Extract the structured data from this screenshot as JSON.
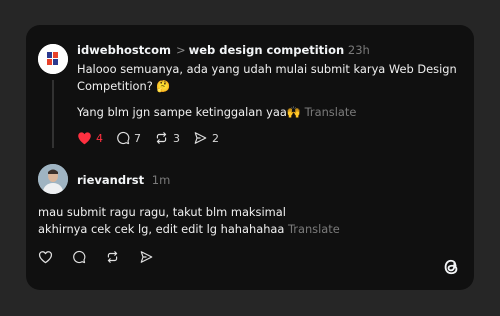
{
  "post": {
    "author": "idwebhostcom",
    "separator": ">",
    "community": "web design competition",
    "time": "23h",
    "line1": "Halooo semuanya, ada yang udah mulai submit karya Web Design",
    "line2": "Competition? 🤔",
    "line3": "Yang blm jgn sampe ketinggalan yaa🙌",
    "translate": "Translate",
    "likes": "4",
    "comments": "7",
    "reposts": "3",
    "shares": "2"
  },
  "reply": {
    "author": "rievandrst",
    "time": "1m",
    "line1": "mau submit ragu ragu, takut blm maksimal",
    "line2": "akhirnya cek cek lg, edit edit lg hahahahaa",
    "translate": "Translate"
  },
  "colors": {
    "like": "#ff3040",
    "card": "#101010",
    "background": "#262626"
  },
  "icons": [
    "heart-filled-icon",
    "comment-icon",
    "repost-icon",
    "share-icon",
    "heart-icon",
    "threads-logo-icon"
  ]
}
